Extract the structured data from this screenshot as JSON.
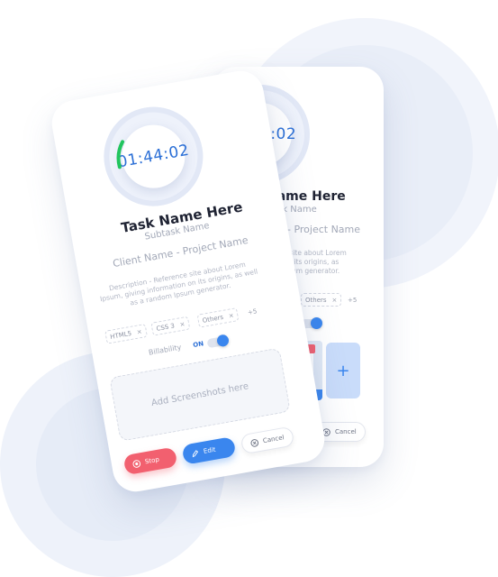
{
  "timer": {
    "value": "01:44:02"
  },
  "task": {
    "title": "Task Name Here",
    "subtitle": "Subtask Name",
    "client_project": "Client Name - Project Name",
    "description": "Description - Reference site about Lorem Ipsum, giving information on its origins, as well as a random Ipsum generator."
  },
  "tags": [
    {
      "label": "HTML5"
    },
    {
      "label": "CSS 3"
    },
    {
      "label": "Others"
    }
  ],
  "tags_more": "+5",
  "tag_remove_glyph": "×",
  "billability": {
    "label": "Billability",
    "state": "ON"
  },
  "dropzone": {
    "label": "Add Screenshots here"
  },
  "buttons": {
    "stop": "Stop",
    "edit": "Edit",
    "cancel": "Cancel"
  },
  "back_card": {
    "timer": "01:44:02",
    "title_fragment": "Name Here",
    "subtitle_fragment": "task Name",
    "client_fragment": "me - Project Name",
    "description_fragment": "rence site about Lorem tion on its origins, as well psum generator.",
    "tag_partial_x": "×",
    "tag_others": "Others",
    "tags_more": "+5",
    "bill_on": "ON",
    "add_glyph": "+",
    "cancel": "Cancel"
  },
  "colors": {
    "accent": "#3a86ee",
    "stop": "#f2606f",
    "timer_progress": "#22c55e",
    "timer_text": "#2b6fd6"
  }
}
